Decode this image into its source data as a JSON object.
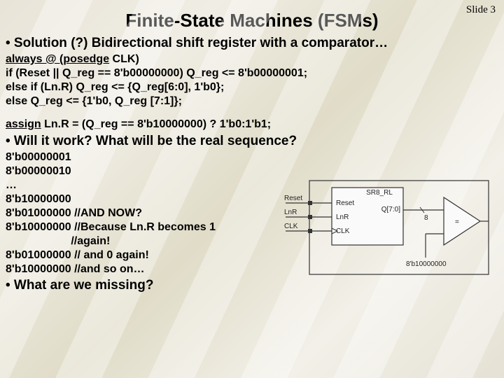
{
  "slide_number": "Slide 3",
  "title": "Finite-State Machines (FSMs)",
  "bullet1": "• Solution (?) Bidirectional shift register with a comparator…",
  "code": {
    "l1a": "always ",
    "l1b": "@ (",
    "l1c": "posedge",
    "l1d": " CLK)",
    "l2": "if (Reset || Q_reg == 8'b00000000) Q_reg <= 8'b00000001;",
    "l3": "else if (Ln.R) Q_reg <= {Q_reg[6:0], 1'b0};",
    "l4": "else Q_reg <= {1'b0, Q_reg [7:1]};"
  },
  "assign": {
    "a": "assign",
    "b": " Ln.R = (Q_reg == 8'b10000000) ? 1'b0:1'b1;"
  },
  "bullet2": "• Will it work? What will be the real sequence?",
  "seq": {
    "s1": "8'b00000001",
    "s2": "8'b00000010",
    "s3": "…",
    "s4": "8'b10000000",
    "s5": "8'b01000000 //AND NOW?",
    "s6": "8'b10000000 //Because Ln.R becomes 1",
    "s7": "                     //again!",
    "s8": "8'b01000000 // and 0 again!",
    "s9": "8'b10000000 //and so on…"
  },
  "bullet3": "• What are we missing?",
  "diagram": {
    "block_name": "SR8_RL",
    "reset_out": "Reset",
    "reset_in": "Reset",
    "lnr_out": "LnR",
    "lnr_in": "LnR",
    "clk_out": "CLK",
    "clk_in": "CLK",
    "qout": "Q[7:0]",
    "bus": "8",
    "compare_val": "8'b10000000",
    "eq": "="
  }
}
